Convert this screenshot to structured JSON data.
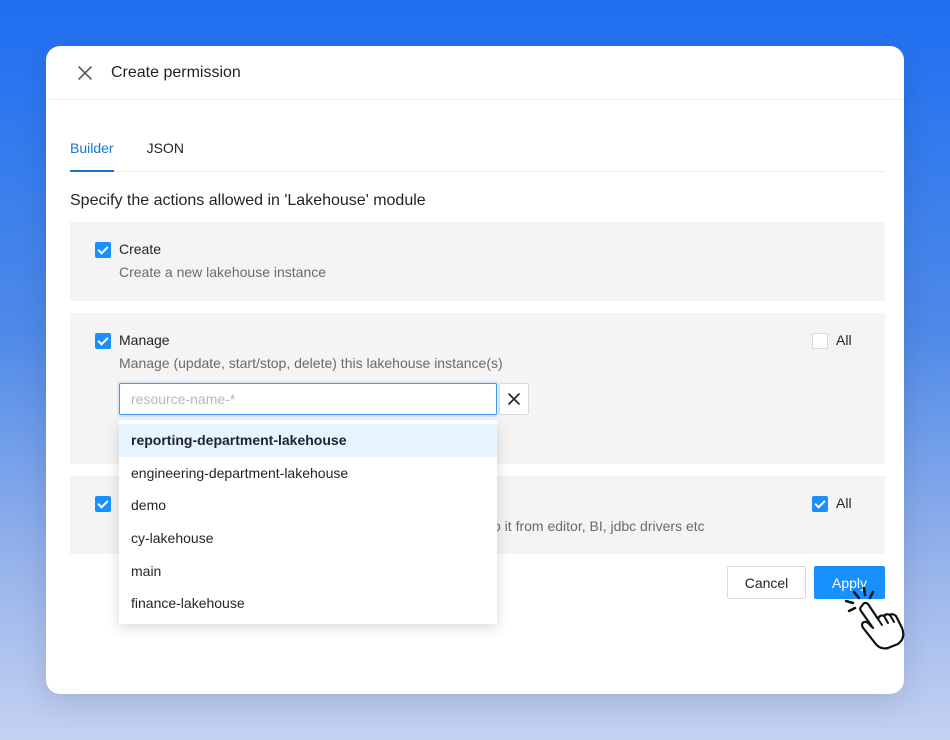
{
  "dialog": {
    "title": "Create permission"
  },
  "tabs": [
    {
      "label": "Builder",
      "active": true
    },
    {
      "label": "JSON",
      "active": false
    }
  ],
  "section_heading": "Specify the actions allowed in 'Lakehouse' module",
  "actions": [
    {
      "label": "Create",
      "description": "Create a new lakehouse instance",
      "checked": true
    },
    {
      "label": "Manage",
      "description": "Manage (update, start/stop, delete) this lakehouse instance(s)",
      "checked": true,
      "all_label": "All",
      "all_checked": false,
      "resource_input": {
        "placeholder": "resource-name-*",
        "value": ""
      }
    },
    {
      "label": "",
      "description": "o it from editor, BI, jdbc drivers etc",
      "checked": true,
      "all_label": "All",
      "all_checked": true
    }
  ],
  "dropdown": {
    "options": [
      {
        "label": "reporting-department-lakehouse",
        "selected": true
      },
      {
        "label": "engineering-department-lakehouse",
        "selected": false
      },
      {
        "label": "demo",
        "selected": false
      },
      {
        "label": "cy-lakehouse",
        "selected": false
      },
      {
        "label": "main",
        "selected": false
      },
      {
        "label": "finance-lakehouse",
        "selected": false
      }
    ]
  },
  "footer": {
    "cancel_label": "Cancel",
    "apply_label": "Apply"
  },
  "colors": {
    "accent": "#1890ff",
    "tab_active": "#1677d8",
    "card_bg": "#f4f4f4"
  }
}
